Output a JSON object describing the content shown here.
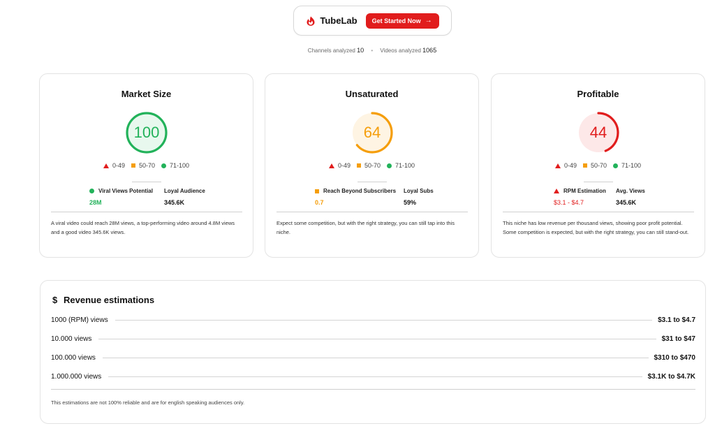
{
  "header": {
    "brand": "TubeLab",
    "cta_label": "Get Started Now",
    "cta_arrow": "→"
  },
  "stats": {
    "channels_label": "Channels analyzed",
    "channels_value": "10",
    "bullet": "•",
    "videos_label": "Videos analyzed",
    "videos_value": "1065"
  },
  "legend": {
    "low": "0-49",
    "mid": "50-70",
    "high": "71-100"
  },
  "colors": {
    "green": "#22b25a",
    "orange": "#f59e0b",
    "red": "#e11d1d"
  },
  "cards": [
    {
      "title": "Market Size",
      "score": "100",
      "score_fraction": 1.0,
      "metric1_label": "Viral Views Potential",
      "metric1_value": "28M",
      "metric2_label": "Loyal Audience",
      "metric2_value": "345.6K",
      "description": "A viral video could reach 28M views, a top-performing video around 4.8M views and a good video 345.6K views."
    },
    {
      "title": "Unsaturated",
      "score": "64",
      "score_fraction": 0.64,
      "metric1_label": "Reach Beyond Subscribers",
      "metric1_value": "0.7",
      "metric2_label": "Loyal Subs",
      "metric2_value": "59%",
      "description": "Expect some competition, but with the right strategy, you can still tap into this niche."
    },
    {
      "title": "Profitable",
      "score": "44",
      "score_fraction": 0.44,
      "metric1_label": "RPM Estimation",
      "metric1_value": "$3.1 - $4.7",
      "metric2_label": "Avg. Views",
      "metric2_value": "345.6K",
      "description": "This niche has low revenue per thousand views, showing poor profit potential. Some competition is expected, but with the right strategy, you can still stand-out."
    }
  ],
  "revenue": {
    "title": "Revenue estimations",
    "icon": "dollar-icon",
    "symbol": "$",
    "rows": [
      {
        "label": "1000 (RPM) views",
        "value": "$3.1 to $4.7"
      },
      {
        "label": "10.000 views",
        "value": "$31 to $47"
      },
      {
        "label": "100.000 views",
        "value": "$310 to $470"
      },
      {
        "label": "1.000.000 views",
        "value": "$3.1K to $4.7K"
      }
    ],
    "note": "This estimations are not 100% reliable and are for english speaking audiences only."
  }
}
